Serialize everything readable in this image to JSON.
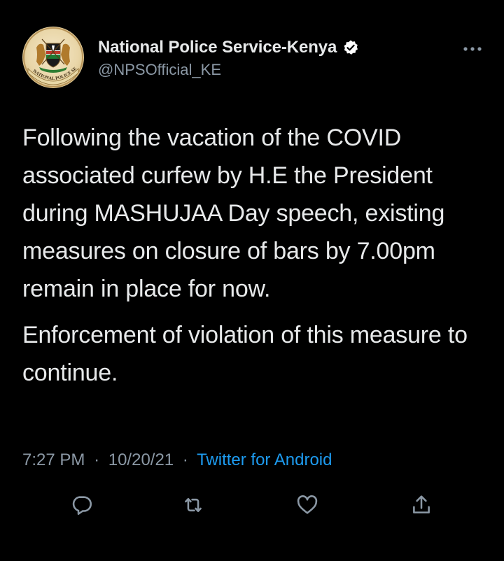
{
  "tweet": {
    "display_name": "National Police Service-Kenya",
    "handle": "@NPSOfficial_KE",
    "paragraphs": [
      "Following the vacation of the COVID associated curfew by H.E the President during MASHUJAA Day speech, existing measures on closure of bars by 7.00pm remain in place for now.",
      "Enforcement of violation of this measure to continue."
    ],
    "time": "7:27 PM",
    "date": "10/20/21",
    "source": "Twitter for Android",
    "separator": "·"
  },
  "avatar": {
    "logo_text": "NATIONAL POLICE SERVICE"
  },
  "icons": {
    "verified": "verified-badge-icon",
    "more": "more-options-icon",
    "reply": "reply-icon",
    "retweet": "retweet-icon",
    "like": "like-icon",
    "share": "share-icon"
  },
  "colors": {
    "background": "#000000",
    "text": "#e7e9ea",
    "secondary": "#8b98a5",
    "link": "#1d9bf0",
    "verified_badge": "#ffffff"
  }
}
